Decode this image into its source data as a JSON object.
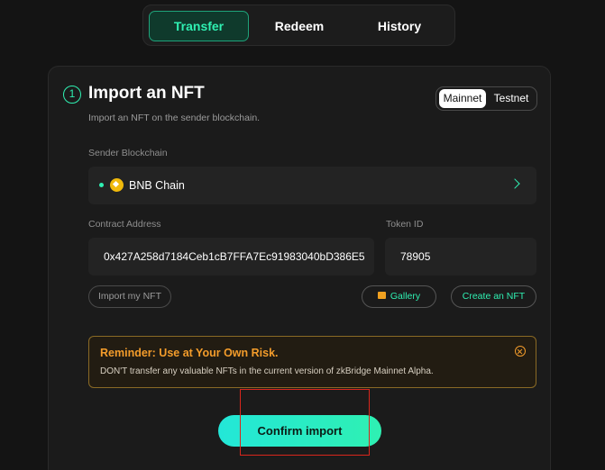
{
  "tabs": [
    {
      "label": "Transfer",
      "active": true
    },
    {
      "label": "Redeem",
      "active": false
    },
    {
      "label": "History",
      "active": false
    }
  ],
  "card": {
    "step_number": "1",
    "title": "Import an NFT",
    "subtitle": "Import an NFT on the sender blockchain.",
    "network": {
      "options": [
        "Mainnet",
        "Testnet"
      ],
      "selected": "Mainnet"
    },
    "sender_blockchain_label": "Sender Blockchain",
    "sender_blockchain_value": "BNB Chain",
    "contract_address_label": "Contract Address",
    "contract_address_value": "0x427A258d7184Ceb1cB7FFA7Ec91983040bD386E5",
    "token_id_label": "Token ID",
    "token_id_value": "78905",
    "import_my_nft_label": "Import my NFT",
    "gallery_label": "Gallery",
    "create_nft_label": "Create an NFT",
    "reminder": {
      "title": "Reminder: Use at Your Own Risk.",
      "text": "DON'T transfer any valuable NFTs in the current version of zkBridge Mainnet Alpha."
    },
    "confirm_label": "Confirm import"
  },
  "colors": {
    "accent": "#2ff0b2",
    "warning": "#f39c2b",
    "background": "#141414",
    "highlight": "#d9261c"
  }
}
